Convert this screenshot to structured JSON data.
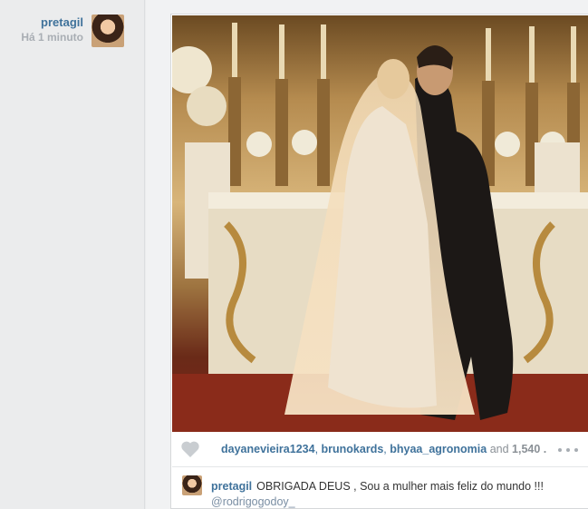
{
  "author": {
    "username": "pretagil",
    "time": "Há 1 minuto"
  },
  "post": {
    "photo_alt": "Wedding photo",
    "likes": {
      "users": [
        "dayanevieira1234",
        "brunokards",
        "bhyaa_agronomia"
      ],
      "and_label": "and",
      "count": "1,540 ..."
    },
    "caption": {
      "username": "pretagil",
      "text": "OBRIGADA DEUS , Sou a mulher mais feliz do mundo !!!",
      "mention": "@rodrigogodoy_"
    }
  },
  "icons": {
    "like": "heart-icon",
    "more": "more-options-icon"
  },
  "colors": {
    "link": "#3f729b",
    "muted": "#a9aeb4",
    "background": "#eaebec"
  }
}
